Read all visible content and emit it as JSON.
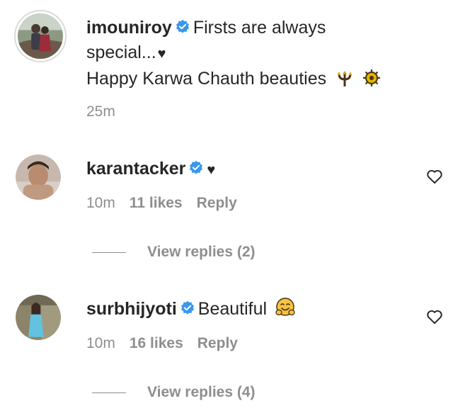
{
  "post": {
    "username": "imouniroy",
    "caption_line1": "Firsts are always",
    "caption_line2": "special...",
    "caption_line3": "Happy Karwa Chauth beauties",
    "time": "25m"
  },
  "comments": [
    {
      "username": "karantacker",
      "text": "",
      "time": "10m",
      "likes": "11 likes",
      "reply": "Reply",
      "view_replies": "View replies (2)"
    },
    {
      "username": "surbhijyoti",
      "text": "Beautiful",
      "time": "10m",
      "likes": "16 likes",
      "reply": "Reply",
      "view_replies": "View replies (4)"
    }
  ],
  "colors": {
    "text": "#262626",
    "secondary": "#8e8e8e",
    "verified": "#3897f0"
  },
  "icons": {
    "verified": "verified-badge-icon",
    "heart": "heart-outline-icon"
  }
}
